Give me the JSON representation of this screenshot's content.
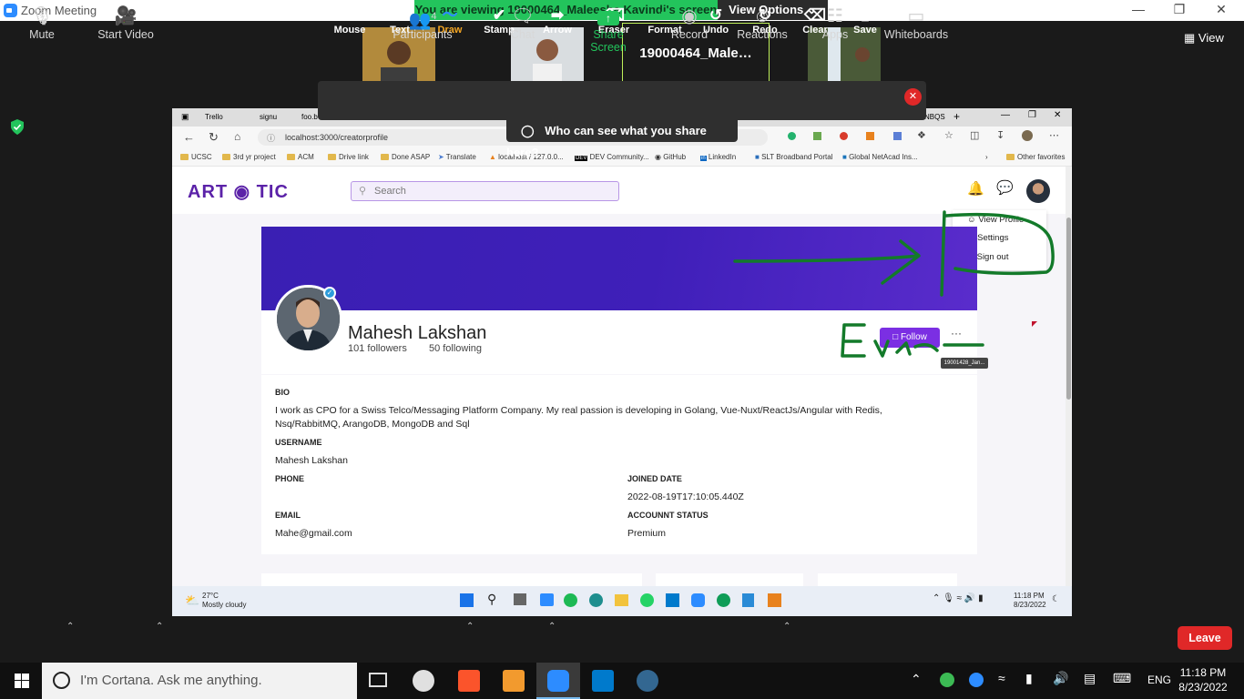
{
  "zoom_window": {
    "title": "Zoom Meeting",
    "viewing_banner": "You are viewing 19000464_Maleesha Kavindi's screen",
    "view_options": "View Options",
    "view_label": "View",
    "minimize": "—",
    "restore": "❐",
    "close": "✕"
  },
  "gallery": {
    "active_speaker_name": "19000464_Male…"
  },
  "annotate_toolbar": {
    "tools": [
      {
        "label": "Mouse",
        "icon": "↖"
      },
      {
        "label": "Text",
        "icon": "T"
      },
      {
        "label": "Draw",
        "icon": "〜"
      },
      {
        "label": "Stamp",
        "icon": "✔"
      },
      {
        "label": "Arrow",
        "icon": "➡"
      },
      {
        "label": "Eraser",
        "icon": "⌫"
      },
      {
        "label": "Format",
        "icon": "■"
      },
      {
        "label": "Undo",
        "icon": "↺"
      },
      {
        "label": "Redo",
        "icon": "↻"
      },
      {
        "label": "Clear",
        "icon": "🗑"
      },
      {
        "label": "Save",
        "icon": "⤓"
      }
    ],
    "active_tool": "Draw",
    "who_can_see": "Who can see what you share here?"
  },
  "browser": {
    "tabs": [
      "Trello",
      "signu",
      "foo.b",
      "NBQS"
    ],
    "url": "localhost:3000/creatorprofile",
    "bookmarks": [
      "UCSC",
      "3rd yr project",
      "ACM",
      "Drive link",
      "Done ASAP",
      "Translate",
      "localhost / 127.0.0...",
      "DEV Community...",
      "GitHub",
      "LinkedIn",
      "SLT Broadband Portal",
      "Global NetAcad Ins..."
    ],
    "other_favorites": "Other favorites"
  },
  "site": {
    "logo": "ART ◉ TIC",
    "search_placeholder": "Search",
    "menu": {
      "view_profile": "View Profile",
      "settings": "Settings",
      "sign_out": "Sign out"
    },
    "profile": {
      "name": "Mahesh Lakshan",
      "followers": "101 followers",
      "following": "50 following",
      "follow_button": "Follow",
      "more": "···",
      "tooltip": "19001428_Jan..."
    },
    "details": {
      "bio_label": "BIO",
      "bio": "I work as CPO for a Swiss Telco/Messaging Platform Company. My real passion is developing in Golang, Vue-Nuxt/ReactJs/Angular with Redis, Nsq/RabbitMQ, ArangoDB, MongoDB and Sql",
      "username_label": "USERNAME",
      "username": "Mahesh Lakshan",
      "phone_label": "PHONE",
      "phone": "",
      "joined_label": "JOINED DATE",
      "joined": "2022-08-19T17:10:05.440Z",
      "email_label": "EMAIL",
      "email": "Mahe@gmail.com",
      "status_label": "ACCOUNNT STATUS",
      "status": "Premium"
    }
  },
  "remote_taskbar": {
    "weather_temp": "27°C",
    "weather_desc": "Mostly cloudy",
    "time": "11:18 PM",
    "date": "8/23/2022"
  },
  "zoom_controls": {
    "mute": "Mute",
    "start_video": "Start Video",
    "participants": "Participants",
    "participants_count": "4",
    "chat": "Chat",
    "share_screen": "Share Screen",
    "record": "Record",
    "reactions": "Reactions",
    "apps": "Apps",
    "whiteboards": "Whiteboards",
    "leave": "Leave"
  },
  "windows_taskbar": {
    "cortana_placeholder": "I'm Cortana. Ask me anything.",
    "language": "ENG",
    "time": "11:18 PM",
    "date": "8/23/2022"
  },
  "colors": {
    "banner_green": "#23c45c",
    "brand_purple": "#7b2fe3",
    "leave_red": "#e02828",
    "annotation_green": "#137a2a"
  }
}
